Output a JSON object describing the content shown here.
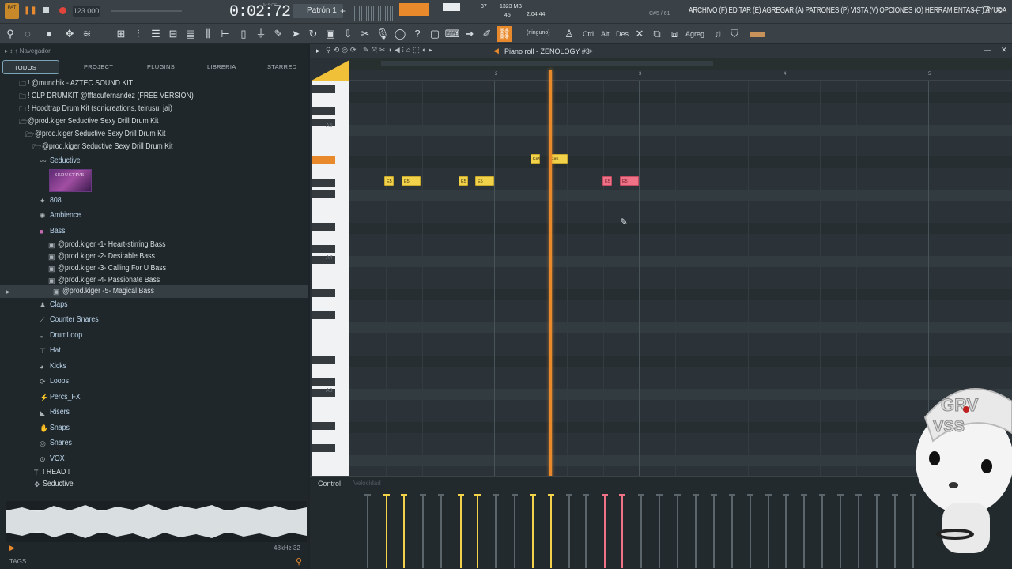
{
  "top": {
    "time": "0:02:72",
    "time_label": "M:S:CS",
    "pattern": "Patrón 1",
    "tempo": "123.000",
    "mode": "PAT",
    "cpu": "37",
    "ram": "1323 MB",
    "poly": "45",
    "clock": "2:04:44",
    "hint": "C#5 / 61",
    "menu": "ARCHIVO (F) EDITAR (E) AGREGAR (A) PATRONES (P) VISTA (V) OPCIONES (O) HERRAMIENTAS (T) AYUDA",
    "snap": "(ninguno)",
    "ctrl": "Ctrl",
    "alt": "Alt",
    "des": "Des.",
    "agreg": "Agreg."
  },
  "browser": {
    "nav": "Navegador",
    "tabs": [
      "TODOS",
      "PROJECT",
      "PLUGINS",
      "LIBRERIA",
      "STARRED"
    ],
    "rows": [
      "! @munchik - AZTEC SOUND KIT",
      "! CLP DRUMKIT @fffacufernandez (FREE VERSION)",
      "! Hoodtrap Drum Kit (sonicreations, teirusu, jai)",
      "@prod.kiger Seductive Sexy Drill Drum Kit",
      "@prod.kiger Seductive Sexy Drill Drum Kit",
      "@prod.kiger Seductive Sexy Drill Drum Kit"
    ],
    "seductive": "Seductive",
    "thumb_text": "SEDUCTIVE",
    "categories": [
      "808",
      "Ambience",
      "Bass"
    ],
    "bass_items": [
      "@prod.kiger -1- Heart-stirring Bass",
      "@prod.kiger -2- Desirable Bass",
      "@prod.kiger -3- Calling For U Bass",
      "@prod.kiger -4- Passionate Bass",
      "@prod.kiger -5- Magical Bass"
    ],
    "more_categories": [
      "Claps",
      "Counter Snares",
      "DrumLoop",
      "Hat",
      "Kicks",
      "Loops",
      "Percs_FX",
      "Risers",
      "Snaps",
      "Snares",
      "VOX"
    ],
    "read": "! READ !",
    "seductive2": "Seductive",
    "sample_info": "48kHz 32",
    "tags": "TAGS"
  },
  "pianoroll": {
    "title": "Piano roll - ZENOLOGY #3",
    "bars": [
      "2",
      "3",
      "4",
      "5"
    ],
    "octaves": [
      "A5",
      "A4",
      "A3"
    ],
    "control": "Control",
    "velocity": "Velocidad",
    "notes": [
      {
        "label": "E5",
        "color": "yellow"
      },
      {
        "label": "E5",
        "color": "yellow"
      },
      {
        "label": "E5",
        "color": "yellow"
      },
      {
        "label": "E5",
        "color": "yellow"
      },
      {
        "label": "F#5",
        "color": "yellow"
      },
      {
        "label": "F#5",
        "color": "yellow"
      },
      {
        "label": "E5",
        "color": "red"
      },
      {
        "label": "E5",
        "color": "red"
      }
    ]
  },
  "colors": {
    "accent": "#e8892b",
    "note": "#f2d24a",
    "note_alt": "#ef7287"
  }
}
